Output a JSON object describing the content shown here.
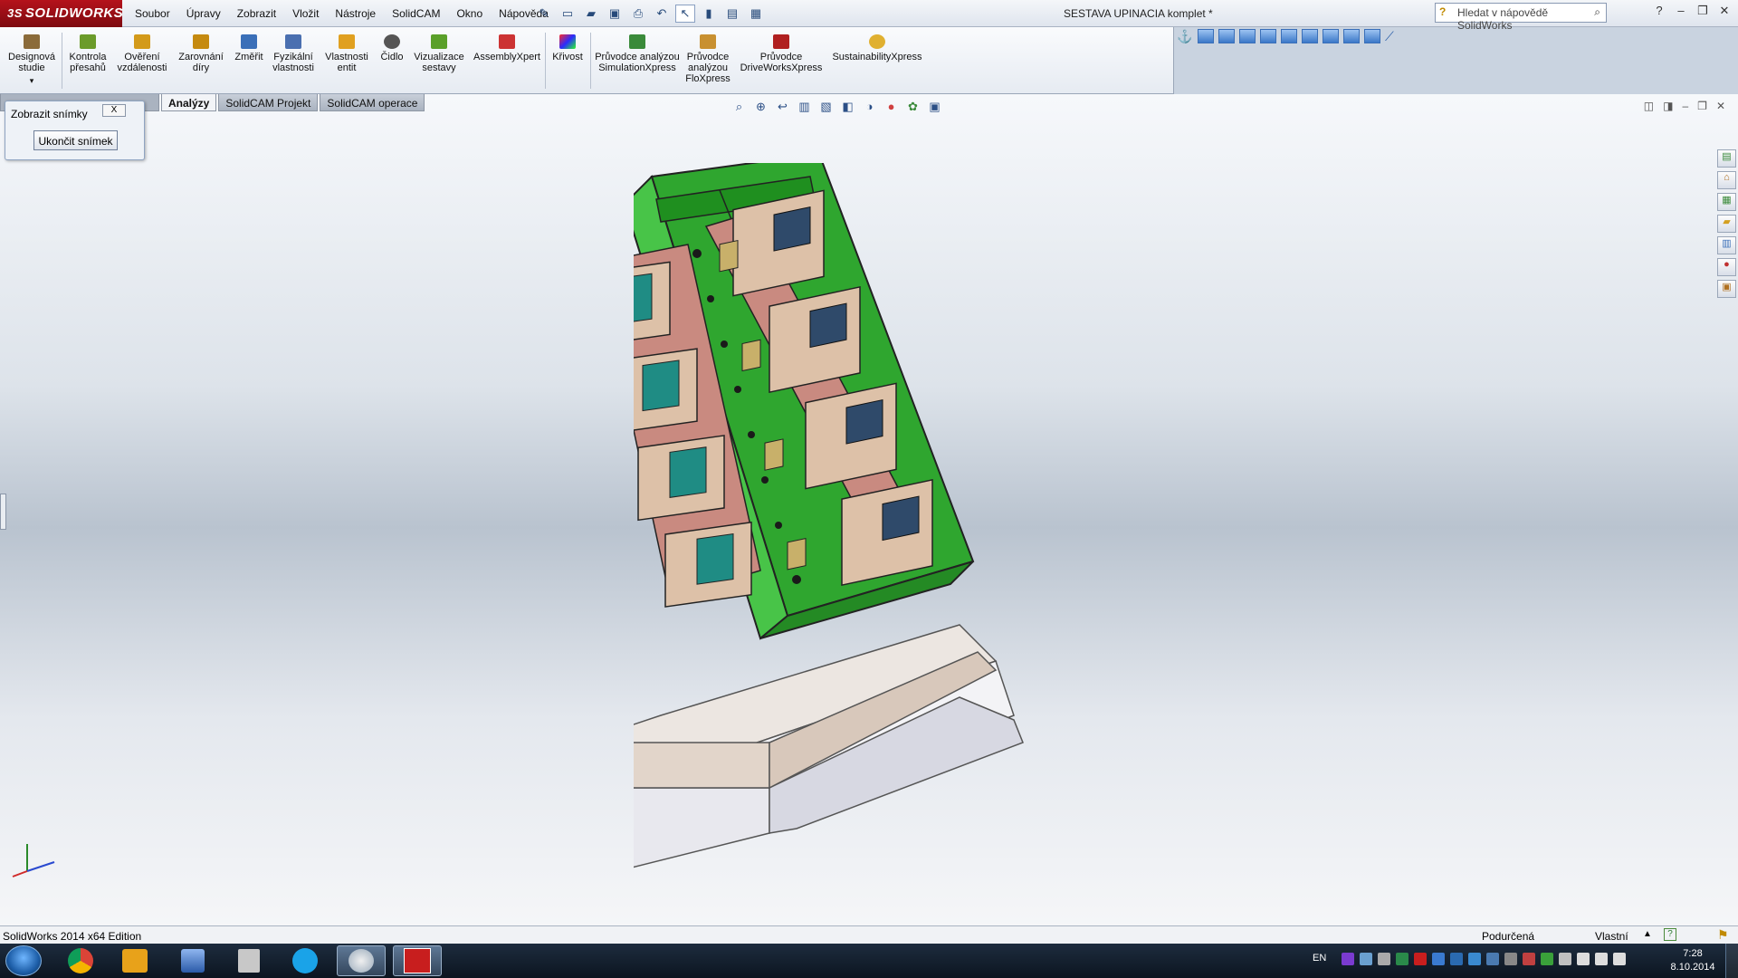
{
  "app": {
    "logo": "SOLIDWORKS",
    "logo_mark": "3S",
    "document_title": "SESTAVA UPINACIA komplet *"
  },
  "menus": [
    "Soubor",
    "Úpravy",
    "Zobrazit",
    "Vložit",
    "Nástroje",
    "SolidCAM",
    "Okno",
    "Nápověda"
  ],
  "help_search": {
    "placeholder": "Hledat v nápovědě SolidWorks"
  },
  "commands": [
    {
      "label": "Designová studie",
      "icon": "design-study-icon",
      "color": "#8b6b3a"
    },
    {
      "label": "Kontrola přesahů",
      "icon": "interference-icon",
      "color": "#6b9b2a"
    },
    {
      "label": "Ověření vzdálenosti",
      "icon": "clearance-icon",
      "color": "#d39a1a"
    },
    {
      "label": "Zarovnání díry",
      "icon": "hole-align-icon",
      "color": "#c58a10"
    },
    {
      "label": "Změřit",
      "icon": "measure-icon",
      "color": "#3a6fb8"
    },
    {
      "label": "Fyzikální vlastnosti",
      "icon": "mass-properties-icon",
      "color": "#4a6fb0"
    },
    {
      "label": "Vlastnosti entit",
      "icon": "section-props-icon",
      "color": "#e0a020"
    },
    {
      "label": "Čidlo",
      "icon": "sensor-icon",
      "color": "#555555"
    },
    {
      "label": "Vizualizace sestavy",
      "icon": "visualization-icon",
      "color": "#5aa02a"
    },
    {
      "label": "AssemblyXpert",
      "icon": "assemblyxpert-icon",
      "color": "#cc3333"
    },
    {
      "label": "Křivost",
      "icon": "curvature-icon",
      "color": "#7a3bd0"
    },
    {
      "label": "Průvodce analýzou SimulationXpress",
      "icon": "simulationxpress-icon",
      "color": "#3a8a3a"
    },
    {
      "label": "Průvodce analýzou FloXpress",
      "icon": "floxpress-icon",
      "color": "#c89030"
    },
    {
      "label": "Průvodce DriveWorksXpress",
      "icon": "driveworksxpress-icon",
      "color": "#b02020"
    },
    {
      "label": "SustainabilityXpress",
      "icon": "sustainabilityxpress-icon",
      "color": "#e0b030"
    }
  ],
  "tabs": [
    {
      "label": "Analýzy",
      "active": true
    },
    {
      "label": "SolidCAM Projekt",
      "active": false
    },
    {
      "label": "SolidCAM operace",
      "active": false
    }
  ],
  "snapshot_dialog": {
    "title": "Zobrazit snímky",
    "close_label": "X",
    "button_label": "Ukončit snímek"
  },
  "status_bar": {
    "edition": "SolidWorks 2014 x64 Edition",
    "state": "Podurčená",
    "units": "Vlastní"
  },
  "taskbar": {
    "apps": [
      "windows-start",
      "chrome",
      "outlook",
      "remote-desktop",
      "paint-tool",
      "skype",
      "paint",
      "solidworks"
    ],
    "language": "EN",
    "time": "7:28",
    "date": "8.10.2014"
  },
  "colors": {
    "model_green": "#2fa62f",
    "plate_beige": "#ddc1a8",
    "plate_red": "#c98a80",
    "block_teal": "#1f8c84",
    "base_light": "#ece8e6"
  }
}
